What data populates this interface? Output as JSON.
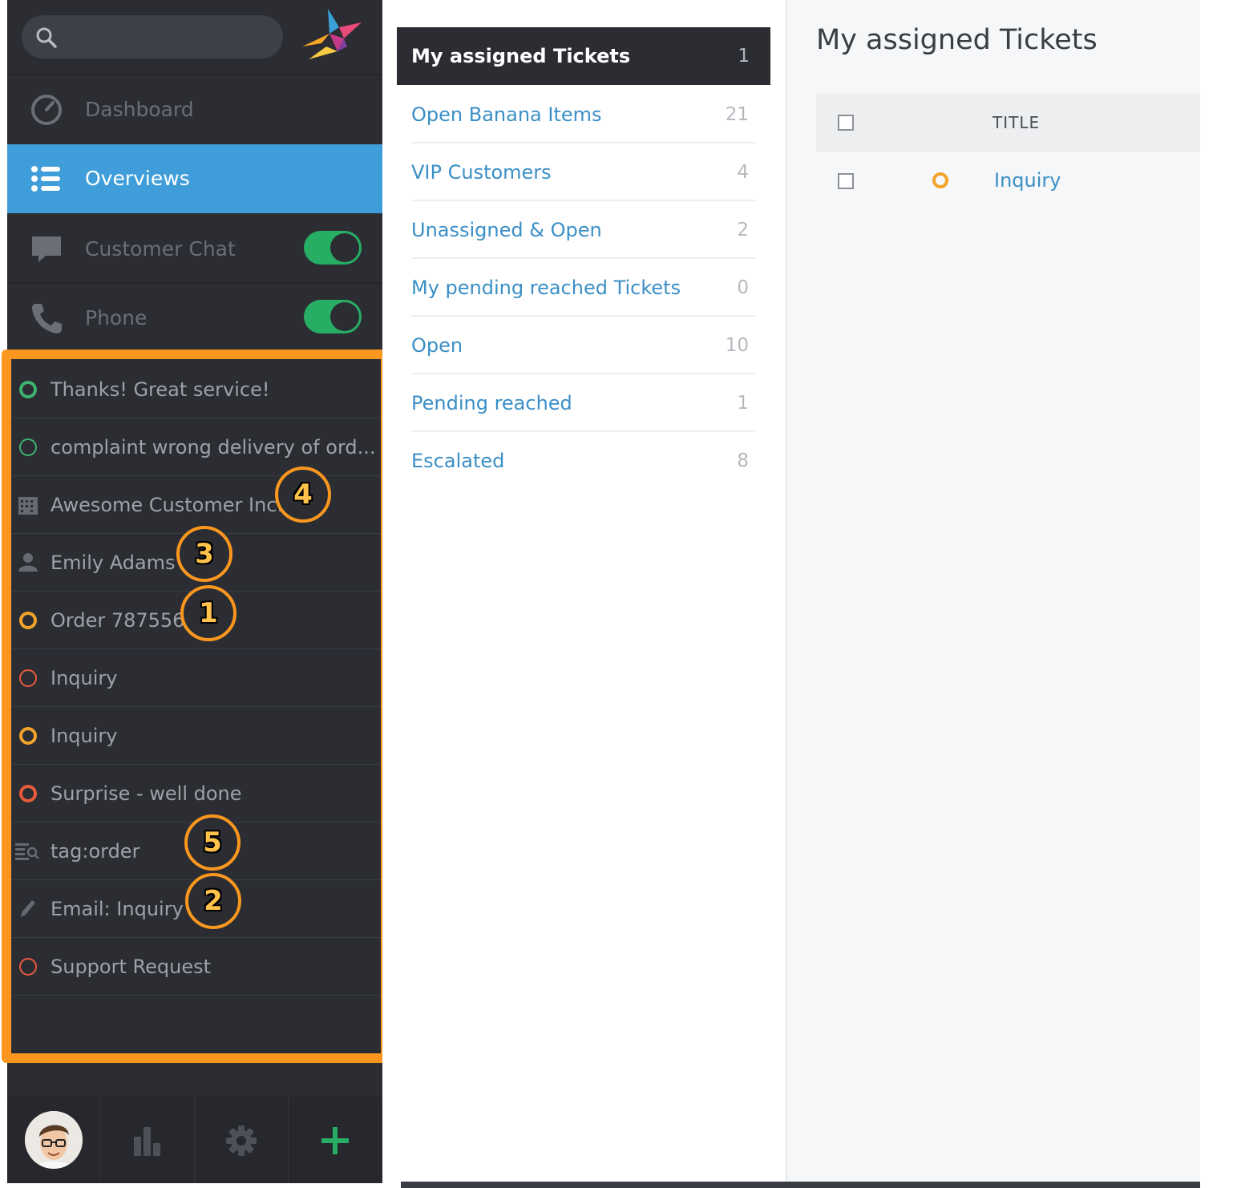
{
  "colors": {
    "sidebar_bg": "#2b2d33",
    "active_blue": "#3f9ed9",
    "toggle_green": "#27ad64",
    "highlight_orange": "#fb971f",
    "link_blue": "#3b8fc6",
    "status_green": "#3cb371",
    "status_yellow": "#f2a32a",
    "status_red": "#e85a3c"
  },
  "sidebar": {
    "search_placeholder": "",
    "nav": [
      {
        "label": "Dashboard",
        "icon": "dashboard-gauge-icon"
      },
      {
        "label": "Overviews",
        "icon": "list-icon",
        "active": true
      },
      {
        "label": "Customer Chat",
        "icon": "chat-bubble-icon",
        "toggle_on": true
      },
      {
        "label": "Phone",
        "icon": "phone-icon",
        "toggle_on": true
      }
    ],
    "tasks": [
      {
        "label": "Thanks! Great service!",
        "icon": "status-ring-green-thick"
      },
      {
        "label": "complaint wrong delivery of ord...",
        "icon": "status-ring-green-thin"
      },
      {
        "label": "Awesome Customer Inc.",
        "icon": "building-icon",
        "callout": "4"
      },
      {
        "label": "Emily Adams",
        "icon": "user-icon",
        "callout": "3"
      },
      {
        "label": "Order 787556",
        "icon": "status-ring-yellow-thick",
        "callout": "1"
      },
      {
        "label": "Inquiry",
        "icon": "status-ring-red-thin"
      },
      {
        "label": "Inquiry",
        "icon": "status-ring-yellow-thick"
      },
      {
        "label": "Surprise - well done",
        "icon": "status-ring-red-thick"
      },
      {
        "label": "tag:order",
        "icon": "search-list-icon",
        "callout": "5"
      },
      {
        "label": "Email: Inquiry",
        "icon": "pencil-icon",
        "callout": "2"
      },
      {
        "label": "Support Request",
        "icon": "status-ring-red-thin"
      }
    ],
    "bottom_bar": [
      "avatar",
      "stats-bars-icon",
      "gear-icon",
      "plus-icon"
    ]
  },
  "overviews": {
    "active": {
      "label": "My assigned Tickets",
      "count": "1"
    },
    "items": [
      {
        "label": "Open Banana Items",
        "count": "21"
      },
      {
        "label": "VIP Customers",
        "count": "4"
      },
      {
        "label": "Unassigned & Open",
        "count": "2"
      },
      {
        "label": "My pending reached Tickets",
        "count": "0"
      },
      {
        "label": "Open",
        "count": "10"
      },
      {
        "label": "Pending reached",
        "count": "1"
      },
      {
        "label": "Escalated",
        "count": "8"
      }
    ]
  },
  "main": {
    "title": "My assigned Tickets",
    "column_title": "TITLE",
    "rows": [
      {
        "title": "Inquiry",
        "status": "status-ring-yellow-thick"
      }
    ]
  }
}
